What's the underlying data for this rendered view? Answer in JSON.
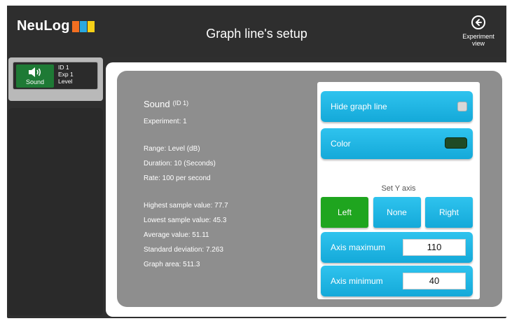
{
  "header": {
    "logo_text": "NeuLog",
    "title": "Graph line's setup",
    "experiment_view_label_1": "Experiment",
    "experiment_view_label_2": "view"
  },
  "sidebar": {
    "sensor": {
      "name": "Sound",
      "info_id": "ID 1",
      "info_exp": "Exp 1",
      "info_mode": "Level",
      "tile_color": "#1e7a35"
    }
  },
  "info": {
    "sensor_name": "Sound",
    "sensor_id": "(ID 1)",
    "experiment": "Experiment: 1",
    "range": "Range: Level (dB)",
    "duration": "Duration: 10 (Seconds)",
    "rate": "Rate: 100 per second",
    "highest": "Highest sample value: 77.7",
    "lowest": "Lowest sample value: 45.3",
    "average": "Average value: 51.11",
    "std_dev": "Standard deviation: 7.263",
    "graph_area": "Graph area: 511.3"
  },
  "settings": {
    "hide_graph_line_label": "Hide graph line",
    "hide_graph_line_checked": false,
    "color_label": "Color",
    "line_color": "#1f4a25",
    "set_y_axis_label": "Set Y axis",
    "y_axis_options": [
      "Left",
      "None",
      "Right"
    ],
    "y_axis_selected": "Left",
    "axis_maximum_label": "Axis maximum",
    "axis_maximum_value": "110",
    "axis_minimum_label": "Axis minimum",
    "axis_minimum_value": "40",
    "accent_color": "#1fb5e6",
    "selected_color": "#1fa51f"
  }
}
